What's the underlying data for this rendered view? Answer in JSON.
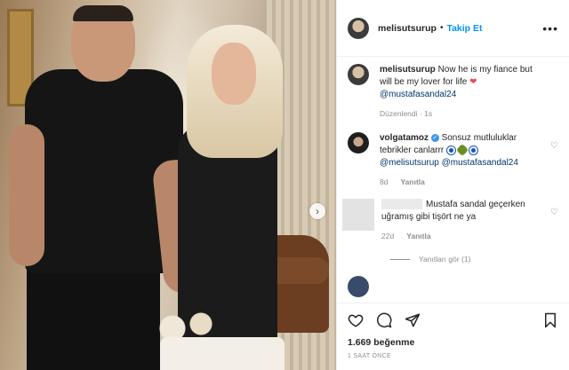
{
  "post": {
    "username": "melisutsurup",
    "follow_label": "Takip Et",
    "separator": "•",
    "more_icon": "more-options-icon"
  },
  "caption": {
    "username": "melisutsurup",
    "text": "Now he is my fiance but will be my lover for life",
    "heart": "❤",
    "mention": "@mustafasandal24",
    "edited_label": "Düzenlendi",
    "time": "1s"
  },
  "comments": [
    {
      "username": "volgatamoz",
      "text": "Sonsuz mutluluklar tebrikler canlarrr",
      "mentions": "@melisutsurup @mustafasandal24",
      "time": "8d",
      "reply_label": "Yanıtla"
    },
    {
      "text": "Mustafa sandal geçerken uğramış gibi tişört ne ya",
      "time": "22d",
      "reply_label": "Yanıtla",
      "view_replies": "Yanıtları gör (1)"
    },
    {
      "username_partial": "",
      "text_partial": ""
    }
  ],
  "actions": {
    "likes": "1.669 beğenme",
    "posted": "1 SAAT ÖNCE"
  },
  "colors": {
    "accent": "#0095f6",
    "link": "#00376b",
    "heart": "#ed4956",
    "muted": "#8e8e8e"
  }
}
